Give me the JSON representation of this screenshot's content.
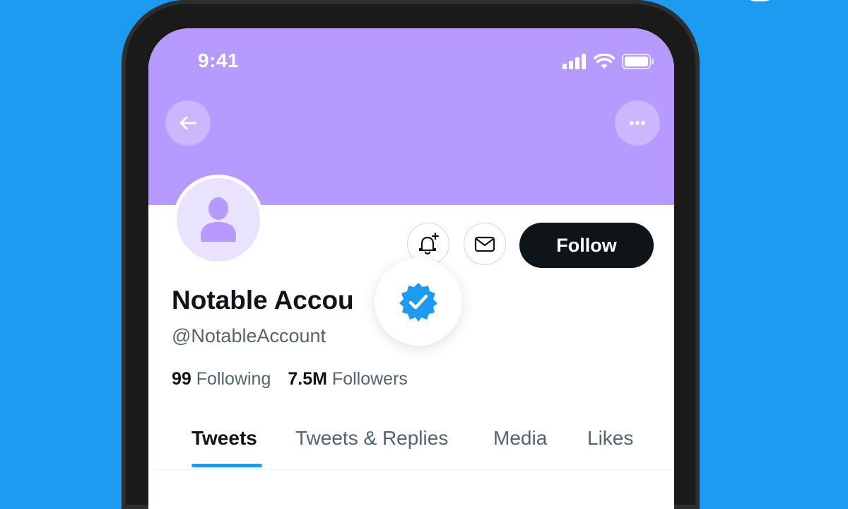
{
  "status_bar": {
    "time": "9:41"
  },
  "profile": {
    "name": "Notable Accou",
    "handle": "@NotableAccount",
    "following_count": "99",
    "following_label": "Following",
    "followers_count": "7.5M",
    "followers_label": "Followers"
  },
  "actions": {
    "follow_label": "Follow"
  },
  "tabs": [
    {
      "label": "Tweets",
      "active": true
    },
    {
      "label": "Tweets & Replies",
      "active": false
    },
    {
      "label": "Media",
      "active": false
    },
    {
      "label": "Likes",
      "active": false
    }
  ],
  "colors": {
    "background": "#1d9bf0",
    "banner": "#b79aff",
    "accent": "#1d9bf0",
    "follow_button": "#0f1419",
    "avatar_fill": "#b79aff"
  }
}
